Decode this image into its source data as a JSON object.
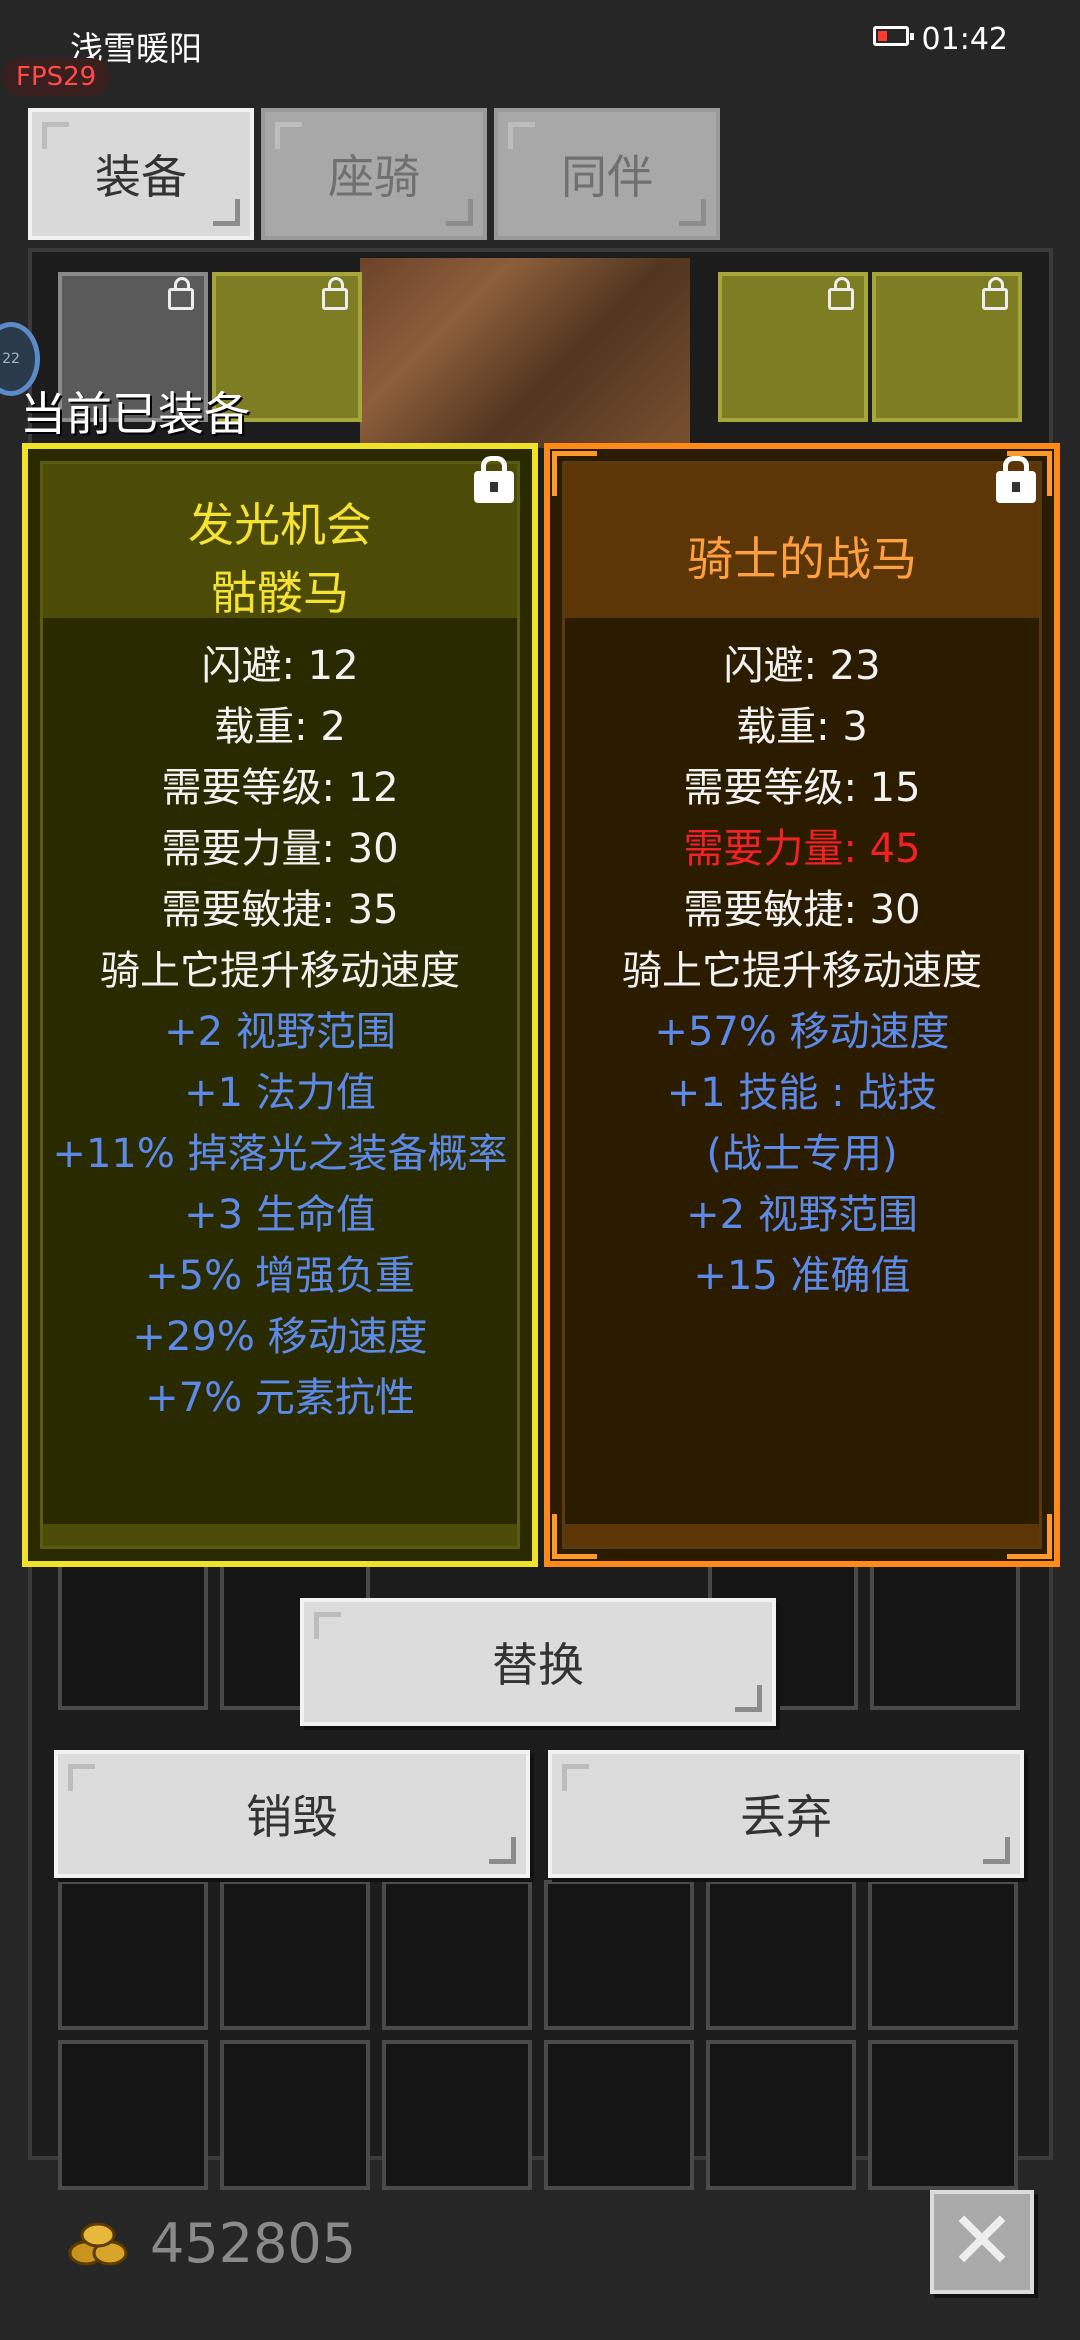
{
  "status_bar": {
    "title": "浅雪暖阳",
    "time": "01:42",
    "fps": "FPS29"
  },
  "tabs": [
    {
      "label": "装备",
      "active": true
    },
    {
      "label": "座骑",
      "active": false
    },
    {
      "label": "同伴",
      "active": false
    }
  ],
  "section_label": "当前已装备",
  "equipped_item": {
    "name": "发光机会",
    "type": "骷髅马",
    "lines": [
      {
        "text": "闪避: 12",
        "color": "white"
      },
      {
        "text": "载重: 2",
        "color": "white"
      },
      {
        "text": "需要等级: 12",
        "color": "white"
      },
      {
        "text": "需要力量: 30",
        "color": "white"
      },
      {
        "text": "需要敏捷: 35",
        "color": "white"
      },
      {
        "text": "骑上它提升移动速度",
        "color": "white"
      },
      {
        "text": "+2 视野范围",
        "color": "blue"
      },
      {
        "text": "+1 法力值",
        "color": "blue"
      },
      {
        "text": "+11% 掉落光之装备概率",
        "color": "blue"
      },
      {
        "text": "+3 生命值",
        "color": "blue"
      },
      {
        "text": "+5% 增强负重",
        "color": "blue"
      },
      {
        "text": "+29% 移动速度",
        "color": "blue"
      },
      {
        "text": "+7% 元素抗性",
        "color": "blue"
      }
    ]
  },
  "candidate_item": {
    "name": "骑士的战马",
    "lines": [
      {
        "text": "闪避: 23",
        "color": "white"
      },
      {
        "text": "载重: 3",
        "color": "white"
      },
      {
        "text": "需要等级: 15",
        "color": "white"
      },
      {
        "text": "需要力量: 45",
        "color": "red"
      },
      {
        "text": "需要敏捷: 30",
        "color": "white"
      },
      {
        "text": "骑上它提升移动速度",
        "color": "white"
      },
      {
        "text": "+57% 移动速度",
        "color": "blue"
      },
      {
        "text": "+1 技能 : 战技",
        "color": "blue"
      },
      {
        "text": "(战士专用)",
        "color": "blue"
      },
      {
        "text": "+2 视野范围",
        "color": "blue"
      },
      {
        "text": "+15 准确值",
        "color": "blue"
      }
    ]
  },
  "actions": {
    "replace": "替换",
    "destroy": "销毁",
    "discard": "丢弃"
  },
  "gold": "452805",
  "colors": {
    "white": "#f2f2f2",
    "blue": "#5d8ae8",
    "red": "#f22222",
    "equipped_border": "#f0e22a",
    "candidate_border": "#ff8a1a"
  }
}
